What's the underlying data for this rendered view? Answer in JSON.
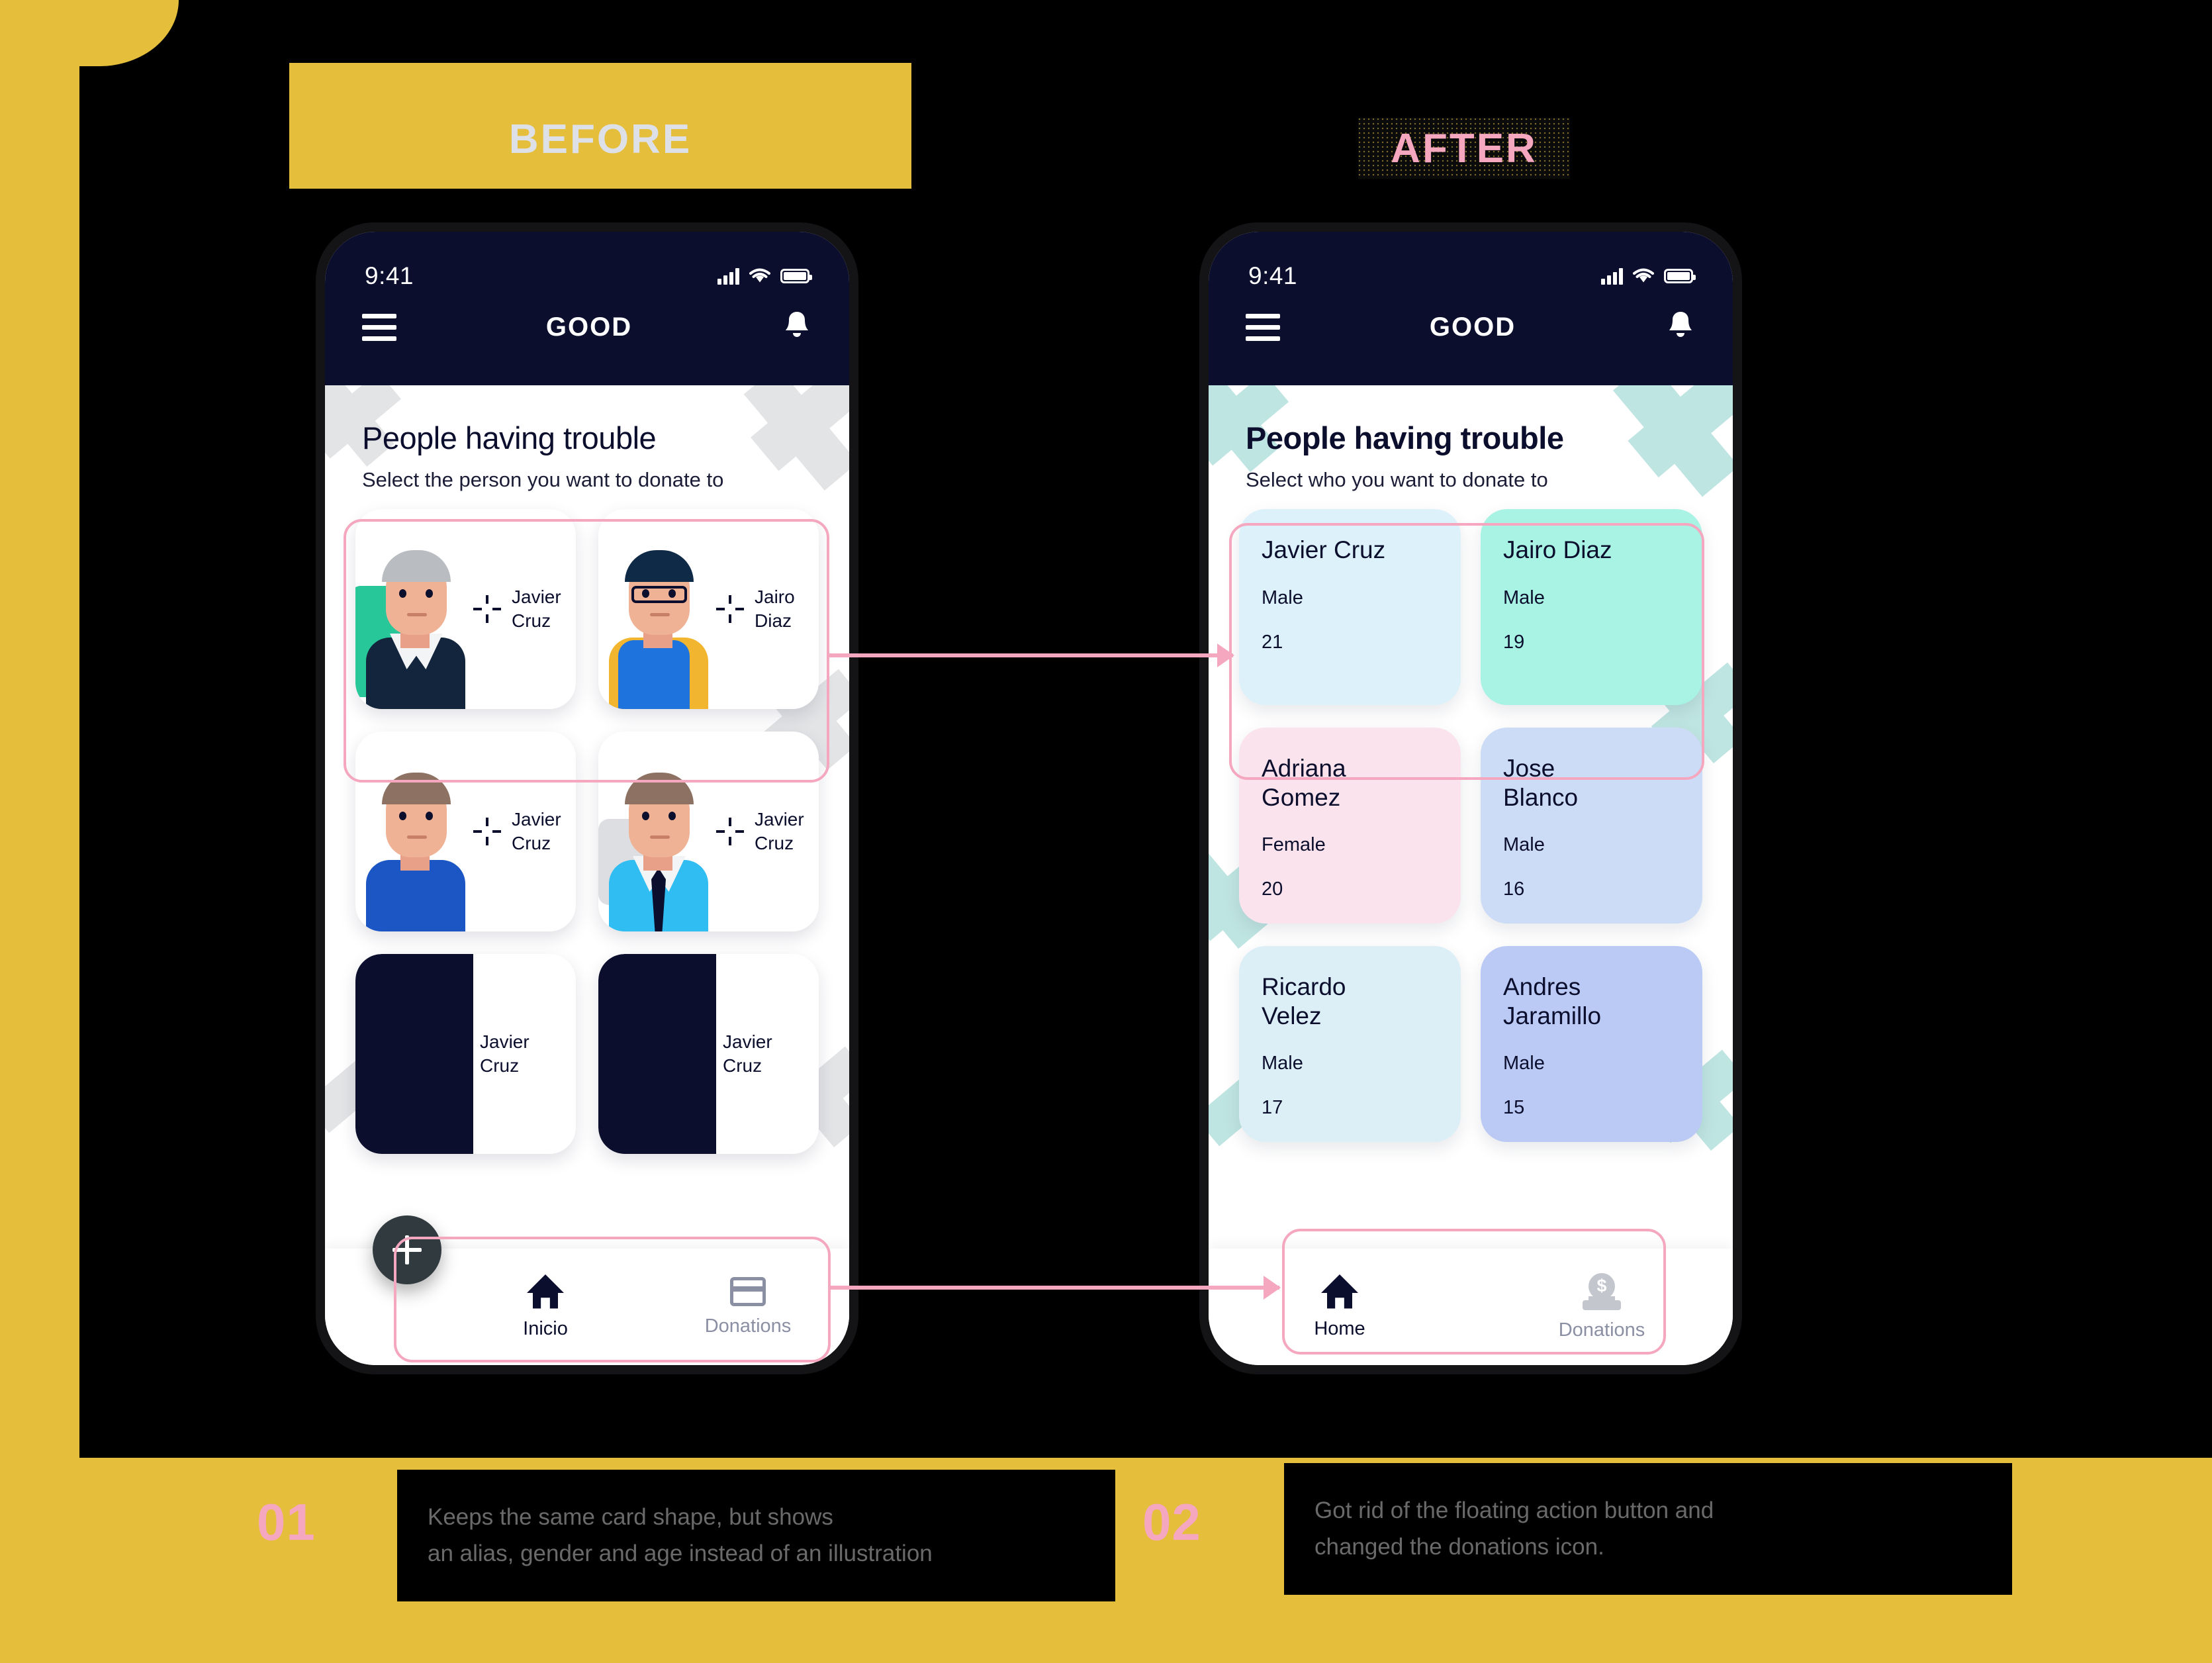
{
  "theme": {
    "yellow": "#E5BE3B",
    "pink": "#F4A7BE",
    "navy": "#0B0E2C",
    "note_text": "#6A6A6A"
  },
  "sections": {
    "before_label": "BEFORE",
    "after_label": "AFTER"
  },
  "before_phone": {
    "statusbar": {
      "time": "9:41",
      "signal_icon": "cellular-signal-icon",
      "wifi_icon": "wifi-icon",
      "battery_icon": "battery-full-icon"
    },
    "appbar": {
      "menu_icon": "hamburger-menu-icon",
      "title": "GOOD",
      "notification_icon": "bell-icon"
    },
    "heading": {
      "title": "People having trouble",
      "subtitle": "Select the person you want to donate to"
    },
    "cards": [
      {
        "name": "Javier\nCruz",
        "style": "elderly-grey-hair"
      },
      {
        "name": "Jairo\nDiaz",
        "style": "young-glasses-hoodie"
      },
      {
        "name": "Javier\nCruz",
        "style": "blue-sweater"
      },
      {
        "name": "Javier\nCruz",
        "style": "shirt-tie"
      },
      {
        "name": "Javier\nCruz",
        "style": "placeholder-dark"
      },
      {
        "name": "Javier\nCruz",
        "style": "placeholder-dark"
      }
    ],
    "fab": {
      "icon": "plus-icon",
      "label": "+"
    },
    "nav": [
      {
        "label": "Inicio",
        "icon": "home-icon",
        "active": true
      },
      {
        "label": "Donations",
        "icon": "credit-card-icon",
        "active": false
      }
    ]
  },
  "after_phone": {
    "statusbar": {
      "time": "9:41",
      "signal_icon": "cellular-signal-icon",
      "wifi_icon": "wifi-icon",
      "battery_icon": "battery-full-icon"
    },
    "appbar": {
      "menu_icon": "hamburger-menu-icon",
      "title": "GOOD",
      "notification_icon": "bell-icon"
    },
    "heading": {
      "title": "People having trouble",
      "subtitle": "Select who you want to donate to"
    },
    "cards": [
      {
        "name": "Javier Cruz",
        "gender": "Male",
        "age": "21",
        "color": "#DCF1FA"
      },
      {
        "name": "Jairo Diaz",
        "gender": "Male",
        "age": "19",
        "color": "#A8F3E4"
      },
      {
        "name": "Adriana\nGomez",
        "gender": "Female",
        "age": "20",
        "color": "#FAE3EC"
      },
      {
        "name": "Jose\nBlanco",
        "gender": "Male",
        "age": "16",
        "color": "#CCDCF6"
      },
      {
        "name": "Ricardo\nVelez",
        "gender": "Male",
        "age": "17",
        "color": "#DCEFF7"
      },
      {
        "name": "Andres\nJaramillo",
        "gender": "Male",
        "age": "15",
        "color": "#BACAF5"
      }
    ],
    "nav": [
      {
        "label": "Home",
        "icon": "home-icon",
        "active": true
      },
      {
        "label": "Donations",
        "icon": "coin-deposit-icon",
        "active": false
      }
    ]
  },
  "notes": [
    {
      "number": "01",
      "line1": "Keeps the same card shape, but shows",
      "line2": "an alias, gender and age instead of an illustration"
    },
    {
      "number": "02",
      "line1": "Got rid of the floating action button and",
      "line2": "changed the donations icon."
    }
  ]
}
